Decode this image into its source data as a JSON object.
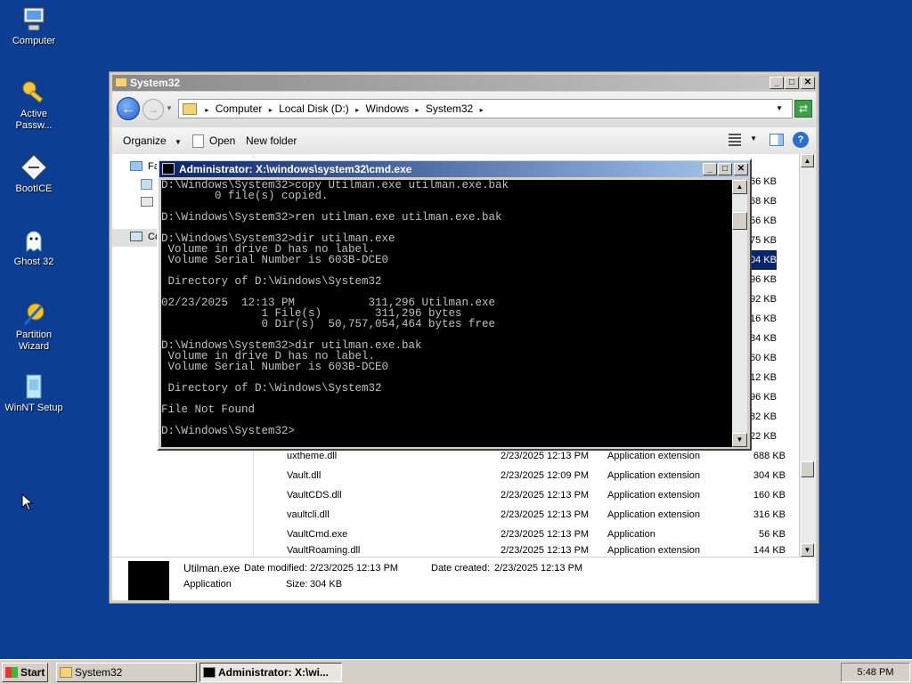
{
  "desktop": {
    "icons": [
      {
        "label": "Computer"
      },
      {
        "label": "Active Passw..."
      },
      {
        "label": "BootICE"
      },
      {
        "label": "Ghost 32"
      },
      {
        "label": "Partition Wizard"
      },
      {
        "label": "WinNT Setup"
      }
    ]
  },
  "explorer": {
    "title": "System32",
    "breadcrumb": [
      "Computer",
      "Local Disk (D:)",
      "Windows",
      "System32"
    ],
    "toolbar": {
      "organize": "Organize",
      "open": "Open",
      "new_folder": "New folder"
    },
    "nav_labels": [
      "Fa",
      "Co"
    ],
    "right_sizes": [
      "66 KB",
      "68 KB",
      "56 KB",
      "75 KB",
      "04 KB",
      "96 KB",
      "92 KB",
      "16 KB",
      "84 KB",
      "60 KB",
      "12 KB",
      "96 KB",
      "82 KB",
      "22 KB"
    ],
    "files": [
      {
        "name": "uxtheme.dll",
        "date": "2/23/2025 12:13 PM",
        "type": "Application extension",
        "size": "688 KB"
      },
      {
        "name": "Vault.dll",
        "date": "2/23/2025 12:09 PM",
        "type": "Application extension",
        "size": "304 KB"
      },
      {
        "name": "VaultCDS.dll",
        "date": "2/23/2025 12:13 PM",
        "type": "Application extension",
        "size": "160 KB"
      },
      {
        "name": "vaultcli.dll",
        "date": "2/23/2025 12:13 PM",
        "type": "Application extension",
        "size": "316 KB"
      },
      {
        "name": "VaultCmd.exe",
        "date": "2/23/2025 12:13 PM",
        "type": "Application",
        "size": "56 KB"
      },
      {
        "name": "VaultRoaming.dll",
        "date": "2/23/2025 12:13 PM",
        "type": "Application extension",
        "size": "144 KB"
      }
    ],
    "details": {
      "filename": "Utilman.exe",
      "filetype": "Application",
      "modified_label": "Date modified:",
      "modified": "2/23/2025 12:13 PM",
      "created_label": "Date created:",
      "created": "2/23/2025 12:13 PM",
      "size_label": "Size:",
      "size": "304 KB"
    }
  },
  "cmd": {
    "title": "Administrator: X:\\windows\\system32\\cmd.exe",
    "lines": [
      "D:\\Windows\\System32>copy Utilman.exe utilman.exe.bak",
      "        0 file(s) copied.",
      "",
      "D:\\Windows\\System32>ren utilman.exe utilman.exe.bak",
      "",
      "D:\\Windows\\System32>dir utilman.exe",
      " Volume in drive D has no label.",
      " Volume Serial Number is 603B-DCE0",
      "",
      " Directory of D:\\Windows\\System32",
      "",
      "02/23/2025  12:13 PM           311,296 Utilman.exe",
      "               1 File(s)        311,296 bytes",
      "               0 Dir(s)  50,757,054,464 bytes free",
      "",
      "D:\\Windows\\System32>dir utilman.exe.bak",
      " Volume in drive D has no label.",
      " Volume Serial Number is 603B-DCE0",
      "",
      " Directory of D:\\Windows\\System32",
      "",
      "File Not Found",
      "",
      "D:\\Windows\\System32>"
    ]
  },
  "taskbar": {
    "start": "Start",
    "buttons": [
      {
        "label": "System32"
      },
      {
        "label": "Administrator: X:\\wi..."
      }
    ],
    "clock": "5:48 PM"
  }
}
